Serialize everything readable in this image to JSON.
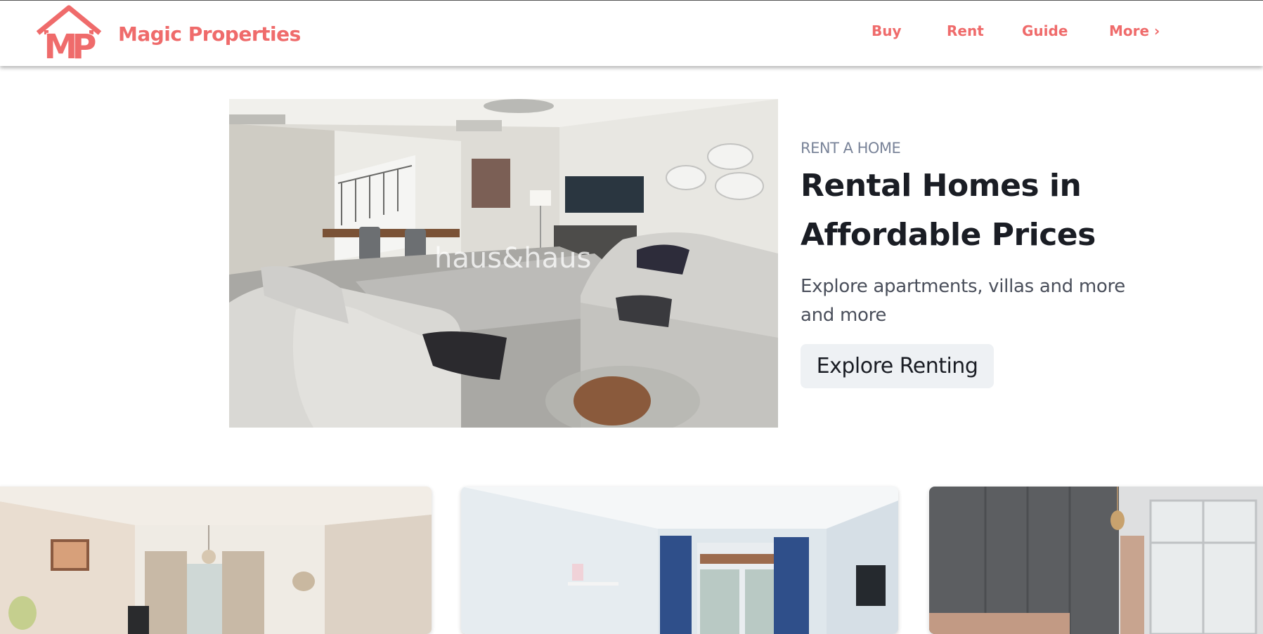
{
  "brand": {
    "name": "Magic Properties",
    "logo_text": "MP",
    "color": "#ef6b6b"
  },
  "nav": {
    "items": [
      {
        "label": "Buy"
      },
      {
        "label": "Rent"
      },
      {
        "label": "Guide"
      },
      {
        "label": "More ›"
      }
    ]
  },
  "hero": {
    "eyebrow": "RENT A HOME",
    "title": "Rental Homes in Affordable Prices",
    "subtitle": "Explore apartments, villas and more and more",
    "cta_label": "Explore Renting",
    "image_watermark": "haus&haus"
  },
  "colors": {
    "accent": "#ef6b6b",
    "button_bg": "#eef1f4",
    "heading": "#1a1d24",
    "eyebrow": "#7a8499"
  }
}
